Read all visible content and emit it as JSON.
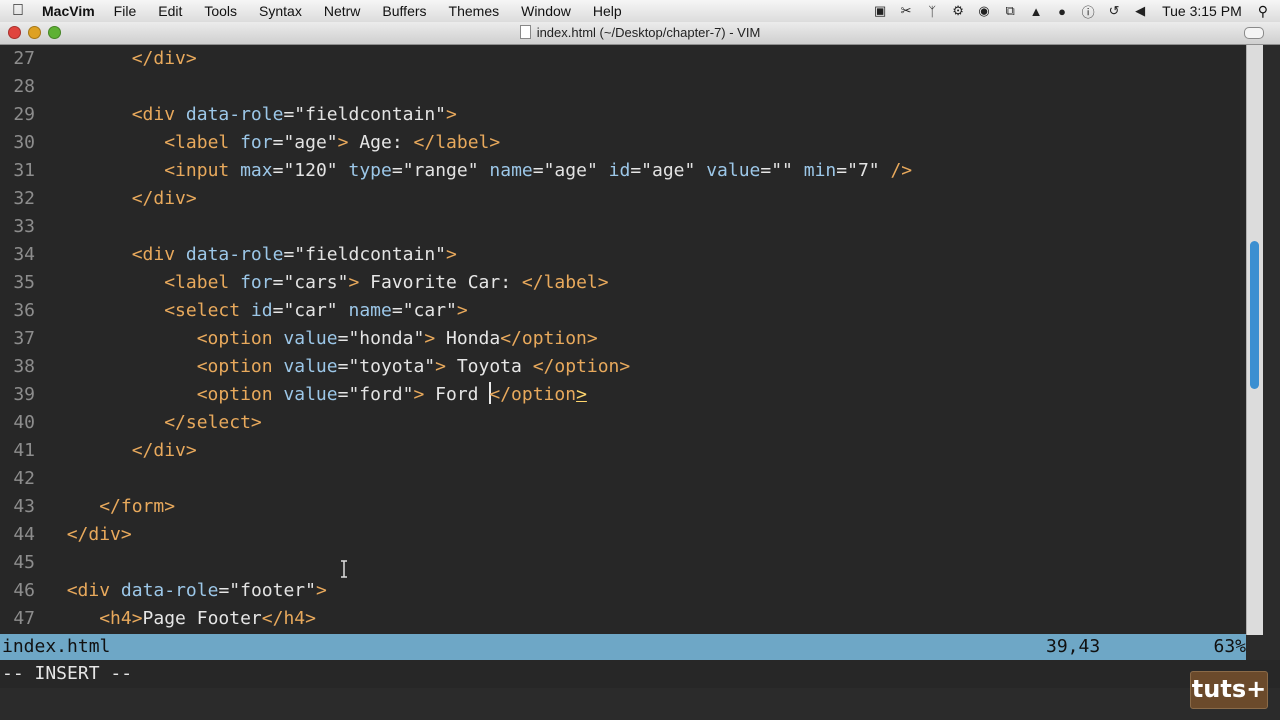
{
  "menubar": {
    "app_name": "MacVim",
    "items": [
      "File",
      "Edit",
      "Tools",
      "Syntax",
      "Netrw",
      "Buffers",
      "Themes",
      "Window",
      "Help"
    ],
    "clock": "Tue 3:15 PM",
    "tray_icons": [
      "camera-icon",
      "scissors-icon",
      "fork-icon",
      "gear-icon",
      "globe-icon",
      "copy-icon",
      "hat-icon",
      "chat-icon",
      "info-icon",
      "timemachine-icon",
      "volume-icon"
    ]
  },
  "window": {
    "title": "index.html (~/Desktop/chapter-7) - VIM"
  },
  "editor": {
    "lines": [
      {
        "n": "27",
        "html": "        <span class=\"tg\">&lt;/div&gt;</span>"
      },
      {
        "n": "28",
        "html": ""
      },
      {
        "n": "29",
        "html": "        <span class=\"tg\">&lt;div</span> <span class=\"at\">data-role</span>=<span class=\"st\">\"fieldcontain\"</span><span class=\"tg\">&gt;</span>"
      },
      {
        "n": "30",
        "html": "           <span class=\"tg\">&lt;label</span> <span class=\"at\">for</span>=<span class=\"st\">\"age\"</span><span class=\"tg\">&gt;</span> Age: <span class=\"tg\">&lt;/label&gt;</span>"
      },
      {
        "n": "31",
        "html": "           <span class=\"tg\">&lt;input</span> <span class=\"at\">max</span>=<span class=\"st\">\"120\"</span> <span class=\"at\">type</span>=<span class=\"st\">\"range\"</span> <span class=\"at\">name</span>=<span class=\"st\">\"age\"</span> <span class=\"at\">id</span>=<span class=\"st\">\"age\"</span> <span class=\"at\">value</span>=<span class=\"st\">\"\"</span> <span class=\"at\">min</span>=<span class=\"st\">\"7\"</span> <span class=\"tg\">/&gt;</span>"
      },
      {
        "n": "32",
        "html": "        <span class=\"tg\">&lt;/div&gt;</span>"
      },
      {
        "n": "33",
        "html": ""
      },
      {
        "n": "34",
        "html": "        <span class=\"tg\">&lt;div</span> <span class=\"at\">data-role</span>=<span class=\"st\">\"fieldcontain\"</span><span class=\"tg\">&gt;</span>"
      },
      {
        "n": "35",
        "html": "           <span class=\"tg\">&lt;label</span> <span class=\"at\">for</span>=<span class=\"st\">\"cars\"</span><span class=\"tg\">&gt;</span> Favorite Car: <span class=\"tg\">&lt;/label&gt;</span>"
      },
      {
        "n": "36",
        "html": "           <span class=\"tg\">&lt;select</span> <span class=\"at\">id</span>=<span class=\"st\">\"car\"</span> <span class=\"at\">name</span>=<span class=\"st\">\"car\"</span><span class=\"tg\">&gt;</span>"
      },
      {
        "n": "37",
        "html": "              <span class=\"tg\">&lt;option</span> <span class=\"at\">value</span>=<span class=\"st\">\"honda\"</span><span class=\"tg\">&gt;</span> Honda<span class=\"tg\">&lt;/option&gt;</span>"
      },
      {
        "n": "38",
        "html": "              <span class=\"tg\">&lt;option</span> <span class=\"at\">value</span>=<span class=\"st\">\"toyota\"</span><span class=\"tg\">&gt;</span> Toyota <span class=\"tg\">&lt;/option&gt;</span>"
      },
      {
        "n": "39",
        "html": "              <span class=\"tg\">&lt;option</span> <span class=\"at\">value</span>=<span class=\"st\">\"ford\"</span><span class=\"tg\">&gt;</span> Ford <span class=\"cursor\"></span><span class=\"tg\">&lt;/option</span><span class=\"hl\">&gt;</span>"
      },
      {
        "n": "40",
        "html": "           <span class=\"tg\">&lt;/select&gt;</span>"
      },
      {
        "n": "41",
        "html": "        <span class=\"tg\">&lt;/div&gt;</span>"
      },
      {
        "n": "42",
        "html": ""
      },
      {
        "n": "43",
        "html": "     <span class=\"tg\">&lt;/form&gt;</span>"
      },
      {
        "n": "44",
        "html": "  <span class=\"tg\">&lt;/div&gt;</span>"
      },
      {
        "n": "45",
        "html": ""
      },
      {
        "n": "46",
        "html": "  <span class=\"tg\">&lt;div</span> <span class=\"at\">data-role</span>=<span class=\"st\">\"footer\"</span><span class=\"tg\">&gt;</span>"
      },
      {
        "n": "47",
        "html": "     <span class=\"tg\">&lt;h4&gt;</span>Page Footer<span class=\"tg\">&lt;/h4&gt;</span>"
      }
    ]
  },
  "statusline": {
    "filename": "index.html",
    "position": "39,43",
    "percent": "63%"
  },
  "cmdline": {
    "mode": "-- INSERT --"
  },
  "watermark": {
    "text": "tuts+"
  },
  "colors": {
    "editor_bg": "#272727",
    "tag": "#e8a95c",
    "attribute": "#9cc7e8",
    "statusline_bg": "#6ea7c6"
  }
}
